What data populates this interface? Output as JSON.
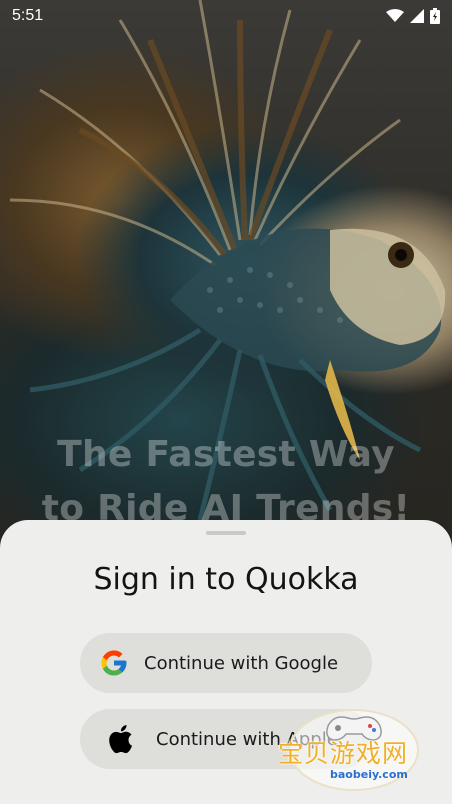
{
  "status_bar": {
    "time": "5:51",
    "icons": [
      "wifi-icon",
      "signal-icon",
      "battery-icon"
    ]
  },
  "hero": {
    "headline_line1": "The Fastest Way",
    "headline_line2": "to Ride AI Trends!"
  },
  "sign_in": {
    "title": "Sign in to Quokka",
    "google_label": "Continue with Google",
    "apple_label": "Continue with Apple"
  },
  "watermark": {
    "text": "宝贝游戏网",
    "url": "baobeiy.com"
  },
  "colors": {
    "sheet_bg": "#eeeeec",
    "button_bg": "#dededb",
    "title_text": "#141414",
    "watermark": "#f2b02a"
  }
}
